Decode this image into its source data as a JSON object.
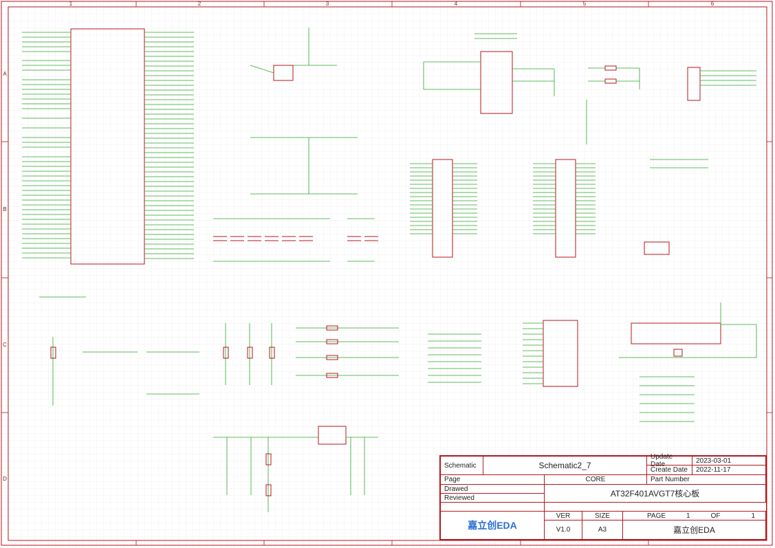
{
  "titleblock": {
    "schematic_label": "Schematic",
    "schematic_name": "Schematic2_7",
    "page_label": "Page",
    "page_name": "CORE",
    "drawed_label": "Drawed",
    "reviewed_label": "Reviewed",
    "update_label": "Update Date",
    "update_value": "2023-03-01",
    "create_label": "Create Date",
    "create_value": "2022-11-17",
    "part_label": "Part Number",
    "board_name": "AT32F401AVGT7核心板",
    "ver_label": "VER",
    "ver_value": "V1.0",
    "size_label": "SIZE",
    "size_value": "A3",
    "pagenum_label": "PAGE",
    "pagenum_value": "1",
    "of_label": "OF",
    "of_value": "1",
    "logo_text": "嘉立创EDA",
    "company": "嘉立创EDA"
  },
  "zones": {
    "cols": [
      "1",
      "2",
      "3",
      "4",
      "5",
      "6"
    ],
    "rows": [
      "A",
      "B",
      "C",
      "D"
    ]
  }
}
